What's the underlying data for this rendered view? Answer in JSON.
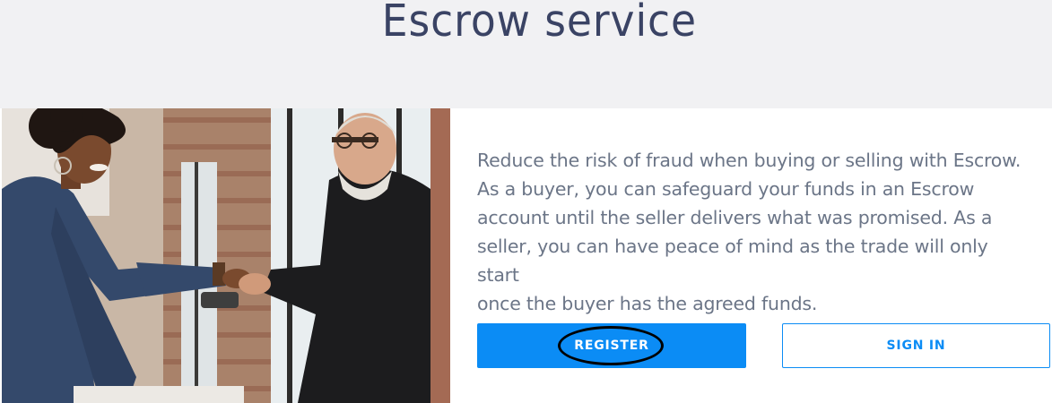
{
  "header": {
    "title": "Escrow service"
  },
  "main": {
    "description": "Reduce the risk of fraud when buying or selling with Escrow. As a buyer, you can safeguard your funds in an Escrow account until the seller delivers what was promised. As a seller, you can have peace of mind as the trade will only start once the buyer has the agreed funds.",
    "description_lines": [
      "Reduce the risk of fraud when buying or selling with Escrow.",
      "As a buyer, you can safeguard your funds in an Escrow",
      "account until the seller delivers what was promised. As a",
      "seller, you can have peace of mind as the trade will only start",
      "once the buyer has the agreed funds."
    ],
    "register_label": "REGISTER",
    "signin_label": "SIGN IN"
  },
  "colors": {
    "accent": "#0b8cf5",
    "title": "#3a4364",
    "body_text": "#6b7587",
    "band": "#f1f1f3"
  }
}
